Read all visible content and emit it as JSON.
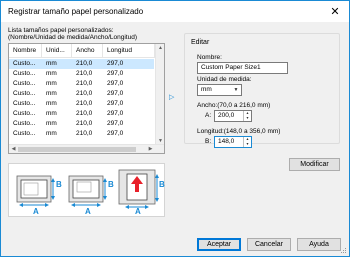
{
  "window": {
    "title": "Registrar tamaño papel personalizado",
    "close_glyph": "✕"
  },
  "list": {
    "label_line1": "Lista tamaños papel personalizados:",
    "label_line2": "(Nombre/Unidad de medida/Ancho/Longitud)",
    "columns": [
      "Nombre",
      "Unid...",
      "Ancho",
      "Longitud"
    ],
    "rows": [
      [
        "Custo...",
        "mm",
        "210,0",
        "297,0"
      ],
      [
        "Custo...",
        "mm",
        "210,0",
        "297,0"
      ],
      [
        "Custo...",
        "mm",
        "210,0",
        "297,0"
      ],
      [
        "Custo...",
        "mm",
        "210,0",
        "297,0"
      ],
      [
        "Custo...",
        "mm",
        "210,0",
        "297,0"
      ],
      [
        "Custo...",
        "mm",
        "210,0",
        "297,0"
      ],
      [
        "Custo...",
        "mm",
        "210,0",
        "297,0"
      ],
      [
        "Custo...",
        "mm",
        "210,0",
        "297,0"
      ]
    ],
    "selected_row": 0
  },
  "transfer_arrow": "▷",
  "edit": {
    "group_title": "Editar",
    "name_label": "Nombre:",
    "name_value": "Custom Paper Size1",
    "unit_label": "Unidad de medida:",
    "unit_value": "mm",
    "width_label": "Ancho:(70,0 a 216,0 mm)",
    "width_prefix": "A:",
    "width_value": "200,0",
    "length_label": "Longitud:(148,0 a 356,0 mm)",
    "length_prefix": "B:",
    "length_value": "148,0"
  },
  "diagram_labels": {
    "a": "A",
    "b": "B"
  },
  "buttons": {
    "modify": "Modificar",
    "ok": "Aceptar",
    "cancel": "Cancelar",
    "help": "Ayuda"
  },
  "colors": {
    "accent": "#1a8ad4",
    "selection": "#cce8ff",
    "highlight_red": "#e8202a"
  }
}
